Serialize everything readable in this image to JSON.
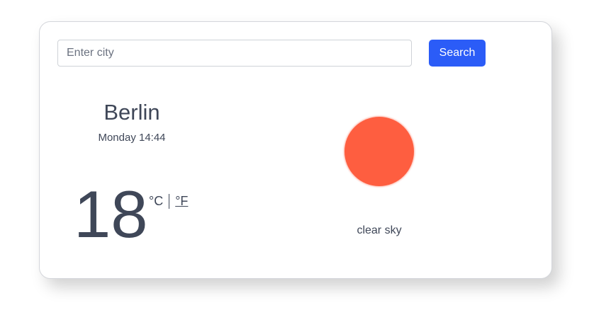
{
  "search": {
    "placeholder": "Enter city",
    "button_label": "Search"
  },
  "weather": {
    "city": "Berlin",
    "datetime": "Monday 14:44",
    "temperature": "18",
    "unit_celsius": "°C",
    "unit_fahrenheit": "°F",
    "description": "clear sky",
    "icon": "sun-icon"
  },
  "colors": {
    "accent": "#2b5cf7",
    "sun": "#fe5e40",
    "text": "#3f4758"
  }
}
